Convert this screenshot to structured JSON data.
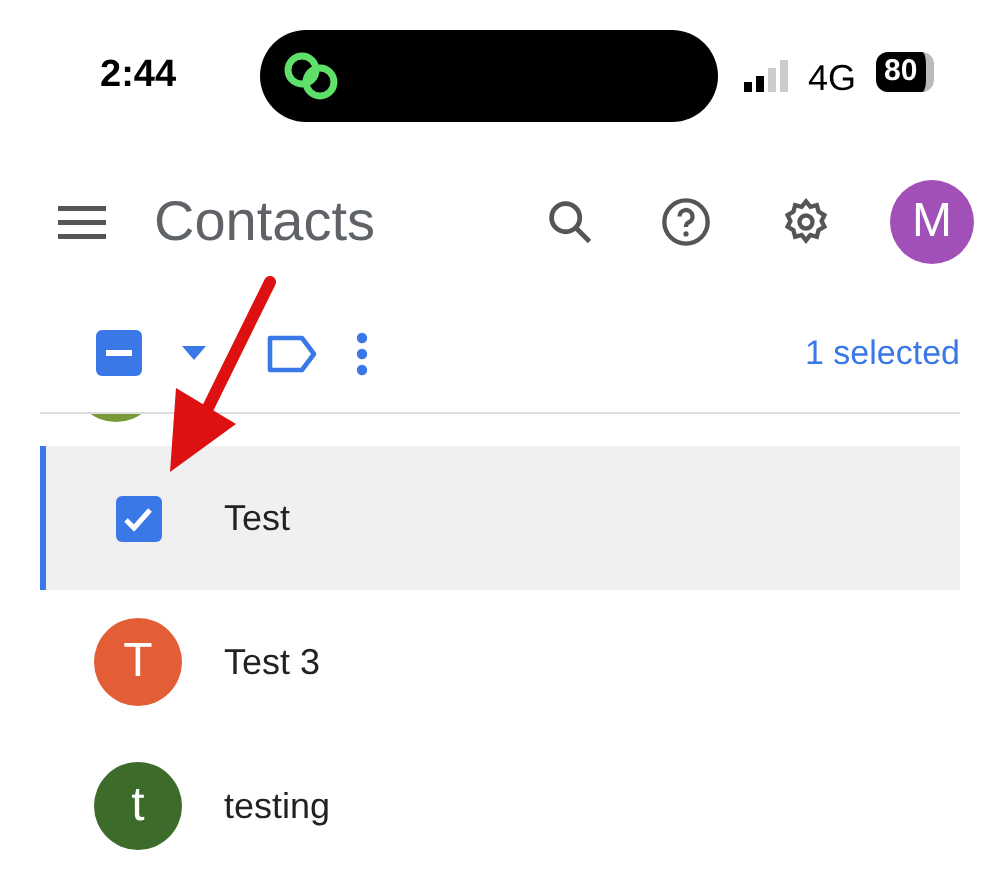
{
  "status_bar": {
    "time": "2:44",
    "network": "4G",
    "battery": "80"
  },
  "header": {
    "title": "Contacts",
    "avatar_initial": "M"
  },
  "toolbar": {
    "selection": "1 selected",
    "select_all_indeterminate": true
  },
  "contacts": [
    {
      "name": "Test",
      "kind": "checkbox",
      "selected": true,
      "checked": true
    },
    {
      "name": "Test 3",
      "kind": "avatar",
      "selected": false,
      "initial": "T",
      "color": "#e35d36"
    },
    {
      "name": "testing",
      "kind": "avatar",
      "selected": false,
      "initial": "t",
      "color": "#3d6b2a"
    }
  ]
}
